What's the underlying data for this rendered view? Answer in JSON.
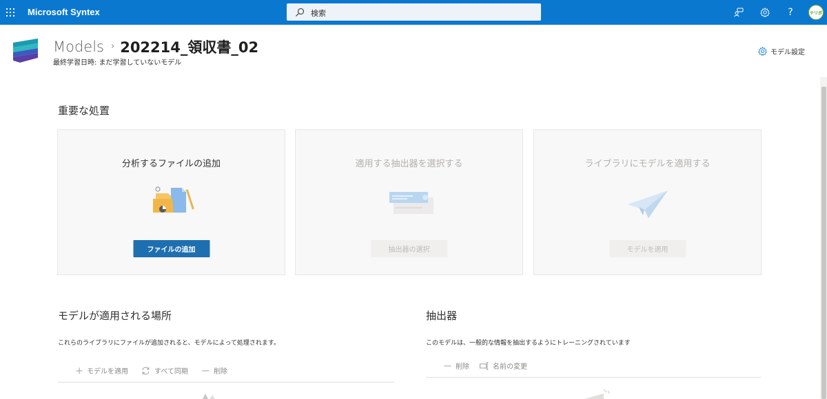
{
  "suite_bar": {
    "app_name": "Microsoft Syntex",
    "search_placeholder": "検索",
    "avatar_text": "テリボ"
  },
  "header": {
    "breadcrumb_root": "Models",
    "breadcrumb_separator": "›",
    "model_name": "202214_領収書_02",
    "last_trained": "最終学習日時: まだ学習していないモデル",
    "settings_label": "モデル設定"
  },
  "important": {
    "title": "重要な処置",
    "cards": [
      {
        "title": "分析するファイルの追加",
        "button": "ファイルの追加",
        "enabled": true
      },
      {
        "title": "適用する抽出器を選択する",
        "button": "抽出器の選択",
        "enabled": false
      },
      {
        "title": "ライブラリにモデルを適用する",
        "button": "モデルを適用",
        "enabled": false
      }
    ]
  },
  "applied_locations": {
    "title": "モデルが適用される場所",
    "description": "これらのライブラリにファイルが追加されると、モデルによって処理されます。",
    "commands": [
      "モデルを適用",
      "すべて同期",
      "削除"
    ]
  },
  "extractors": {
    "title": "抽出器",
    "description": "このモデルは、一般的な情報を抽出するようにトレーニングされています",
    "commands": [
      "削除",
      "名前の変更"
    ]
  },
  "colors": {
    "suite_bar": "#0b78d0",
    "primary_button": "#1e6fb0",
    "card_background": "#f8f8f8"
  },
  "icons": {
    "waffle": "app-launcher-icon",
    "search": "search-icon",
    "feedback": "people-icon",
    "settings": "gear-icon",
    "help": "help-icon"
  }
}
